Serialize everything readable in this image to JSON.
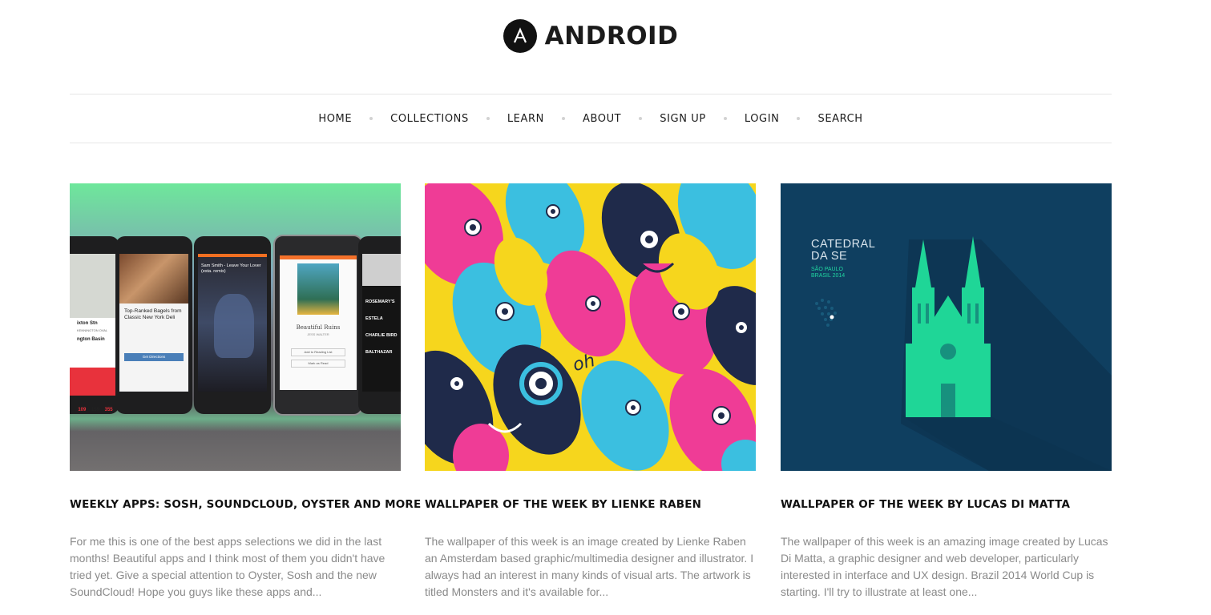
{
  "brand": {
    "name": "ANDROID",
    "logo_icon": "android-a-circle-icon"
  },
  "nav": {
    "items": [
      "HOME",
      "COLLECTIONS",
      "LEARN",
      "ABOUT",
      "SIGN UP",
      "LOGIN",
      "SEARCH"
    ]
  },
  "posts": [
    {
      "title": "WEEKLY APPS: SOSH, SOUNDCLOUD, OYSTER AND MORE",
      "excerpt": "For me this is one of the best apps selections we did in the last months! Beautiful apps and I think most of them you didn't have tried yet. Give a special attention to Oyster, Sosh and the new SoundCloud! Hope you guys like these apps and...",
      "image": {
        "phone1_lines": [
          "ixton Stn",
          "KENNINGTON OVAL",
          "ngton Basin"
        ],
        "phone1_numbers": [
          "109",
          "159",
          "355"
        ],
        "phone2_card": "Top-Ranked Bagels from Classic New York Deli",
        "phone2_button": "Get Directions",
        "phone3_track": "Sam Smith - Leave Your Lover (esta. remix)",
        "phone4_book_title": "Beautiful Ruins",
        "phone4_author": "JESS WALTER",
        "phone4_buttons": [
          "Add to Reading List",
          "Mark as Read"
        ],
        "phone5_items": [
          "ROSEMARY'S",
          "ESTELA",
          "CHARLIE BIRD",
          "BALTHAZAR"
        ]
      }
    },
    {
      "title": "WALLPAPER OF THE WEEK BY LIENKE RABEN",
      "excerpt": "The wallpaper of this week is an image created by Lienke Raben an Amsterdam based graphic/multimedia designer and illustrator. I always had an interest in many kinds of visual arts. The artwork is titled Monsters and it's available for...",
      "image": {
        "speech": "oh"
      }
    },
    {
      "title": "WALLPAPER OF THE WEEK BY LUCAS DI MATTA",
      "excerpt": "The wallpaper of this week is an amazing image created by Lucas Di Matta, a graphic designer and web developer, particularly interested in interface and UX design. Brazil 2014 World Cup is starting. I'll try to illustrate at least one...",
      "image": {
        "heading_line1": "CATEDRAL",
        "heading_line2": "DA SE",
        "sub_line1": "SÃO PAULO",
        "sub_line2": "BRASIL 2014"
      }
    }
  ],
  "colors": {
    "nav_separator": "#d2d2d2",
    "excerpt": "#8a8a8a",
    "cathedral_green": "#1fd697",
    "cathedral_bg": "#0f3f60"
  }
}
